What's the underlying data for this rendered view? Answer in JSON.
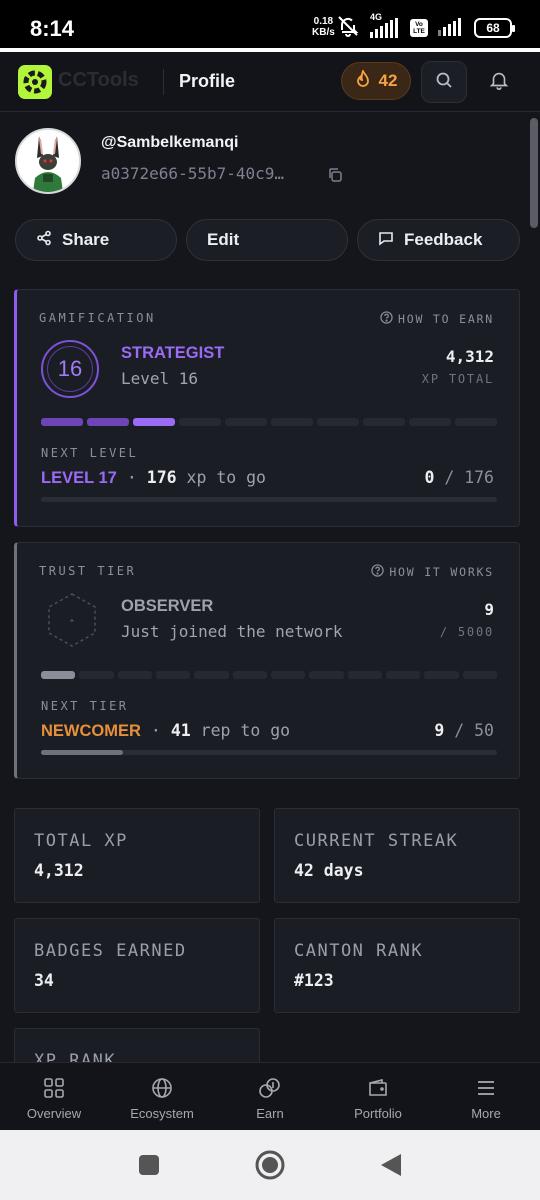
{
  "status_bar": {
    "time": "8:14",
    "speed_value": "0.18",
    "speed_unit": "KB/s",
    "network": "4G",
    "volte": "Vo LTE",
    "battery": "68"
  },
  "header": {
    "brand": "CCTools",
    "title": "Profile",
    "streak": "42",
    "accent_color": "#f6a341"
  },
  "profile": {
    "username": "@Sambelkemanqi",
    "user_id": "a0372e66-55b7-40c9…"
  },
  "actions": {
    "share": "Share",
    "edit": "Edit",
    "feedback": "Feedback"
  },
  "gamification": {
    "kicker": "GAMIFICATION",
    "how_to": "HOW TO EARN",
    "level_number": "16",
    "tier": "STRATEGIST",
    "level_label": "Level 16",
    "xp_total": "4,312",
    "xp_total_label": "XP TOTAL",
    "segments_total": 10,
    "segments_done": 2,
    "segment_current": 3,
    "next_label": "NEXT LEVEL",
    "next_level": "LEVEL 17",
    "dot": "·",
    "to_go_amount": "176",
    "to_go_text": "xp to go",
    "progress_current": "0",
    "progress_sep": "/",
    "progress_max": "176",
    "progress_fraction": 0,
    "accent_color": "#9a6bf5"
  },
  "trust": {
    "kicker": "TRUST TIER",
    "how_to": "HOW IT WORKS",
    "tier": "OBSERVER",
    "subtitle": "Just joined the network",
    "rep": "9",
    "rep_max": "/ 5000",
    "segments_total": 12,
    "segment_current": 1,
    "next_label": "NEXT TIER",
    "next_tier": "NEWCOMER",
    "dot": "·",
    "to_go_amount": "41",
    "to_go_text": "rep to go",
    "progress_current": "9",
    "progress_sep": "/",
    "progress_max": "50",
    "progress_fraction": 0.18,
    "accent_color": "#e6903a"
  },
  "stats": [
    {
      "label": "TOTAL XP",
      "value": "4,312"
    },
    {
      "label": "CURRENT STREAK",
      "value": "42 days"
    },
    {
      "label": "BADGES EARNED",
      "value": "34"
    },
    {
      "label": "CANTON RANK",
      "value": "#123"
    },
    {
      "label": "XP RANK",
      "value": ""
    }
  ],
  "nav": [
    {
      "label": "Overview",
      "icon": "grid-icon"
    },
    {
      "label": "Ecosystem",
      "icon": "globe-icon"
    },
    {
      "label": "Earn",
      "icon": "coins-icon"
    },
    {
      "label": "Portfolio",
      "icon": "wallet-icon"
    },
    {
      "label": "More",
      "icon": "menu-icon"
    }
  ]
}
